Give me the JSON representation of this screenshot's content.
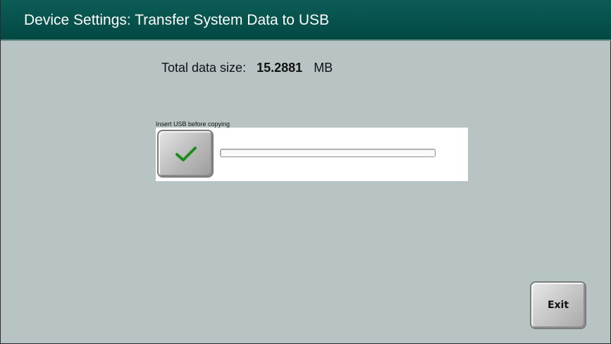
{
  "window": {
    "title": "Device Settings: Transfer System Data to USB"
  },
  "data_size": {
    "label": "Total data size:",
    "value": "15.2881",
    "unit": "MB"
  },
  "usb": {
    "instruction": "Insert USB before copying",
    "confirm_icon": "checkmark-icon",
    "check_color": "#1f8a1f",
    "progress": 0
  },
  "footer": {
    "exit_label": "Exit"
  },
  "colors": {
    "title_bar": "#034843",
    "background": "#b8c3c4"
  }
}
